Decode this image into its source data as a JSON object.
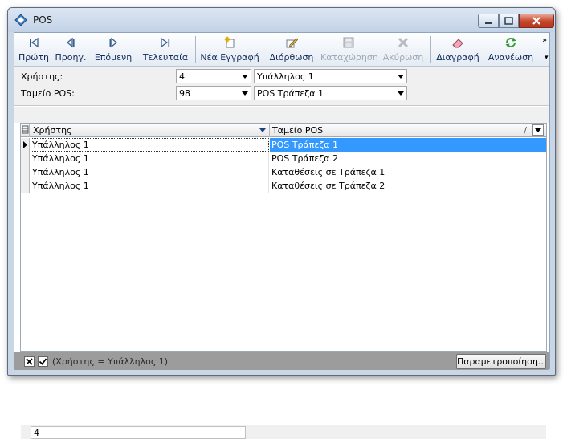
{
  "window": {
    "title": "POS"
  },
  "toolbar": {
    "buttons": [
      {
        "label": "Πρώτη",
        "icon": "first-record-icon",
        "enabled": true
      },
      {
        "label": "Προηγ.",
        "icon": "previous-record-icon",
        "enabled": true
      },
      {
        "label": "Επόμενη",
        "icon": "next-record-icon",
        "enabled": true
      },
      {
        "label": "Τελευταία",
        "icon": "last-record-icon",
        "enabled": true
      },
      {
        "label": "Νέα Εγγραφή",
        "icon": "new-record-icon",
        "enabled": true
      },
      {
        "label": "Διόρθωση",
        "icon": "edit-icon",
        "enabled": true
      },
      {
        "label": "Καταχώρηση",
        "icon": "save-icon",
        "enabled": false
      },
      {
        "label": "Ακύρωση",
        "icon": "cancel-icon",
        "enabled": false
      },
      {
        "label": "Διαγραφή",
        "icon": "delete-eraser-icon",
        "enabled": true
      },
      {
        "label": "Ανανέωση",
        "icon": "refresh-icon",
        "enabled": true
      }
    ]
  },
  "filters": {
    "user": {
      "label": "Χρήστης:",
      "code": "4",
      "name": "Υπάλληλος 1"
    },
    "pos": {
      "label": "Ταμείο POS:",
      "code": "98",
      "name": "POS Τράπεζα 1"
    }
  },
  "grid": {
    "columns": [
      "Χρήστης",
      "Ταμείο POS"
    ],
    "sort_indicator": "/",
    "rows": [
      {
        "user": "Υπάλληλος 1",
        "pos": "POS Τράπεζα 1",
        "selected": true
      },
      {
        "user": "Υπάλληλος 1",
        "pos": "POS Τράπεζα 2",
        "selected": false
      },
      {
        "user": "Υπάλληλος 1",
        "pos": "Καταθέσεις σε Τράπεζα 1",
        "selected": false
      },
      {
        "user": "Υπάλληλος 1",
        "pos": "Καταθέσεις σε Τράπεζα 2",
        "selected": false
      }
    ],
    "footer_count": "4"
  },
  "filter_bar": {
    "expression": "(Χρήστης = Υπάλληλος 1)",
    "customize_label": "Παραμετροποίηση..."
  },
  "colors": {
    "selection": "#3399ff",
    "filter_bar": "#9c9c9c",
    "close_button": "#c4452b"
  }
}
